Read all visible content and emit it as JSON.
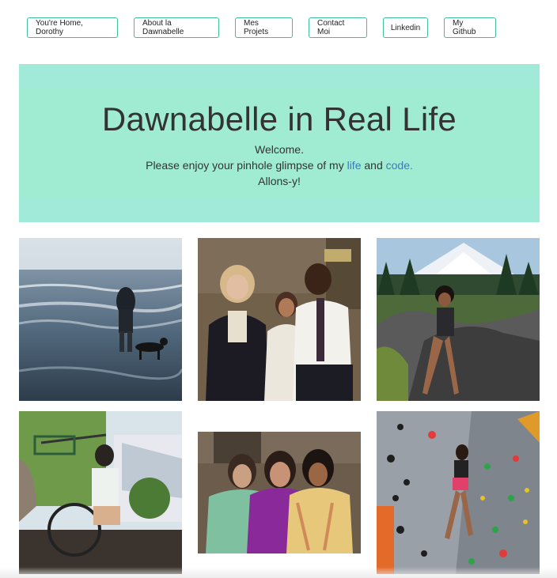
{
  "nav": {
    "items": [
      {
        "label": "You're Home, Dorothy"
      },
      {
        "label": "About la Dawnabelle"
      },
      {
        "label": "Mes Projets"
      },
      {
        "label": "Contact Moi"
      },
      {
        "label": "Linkedin"
      },
      {
        "label": "My Github"
      }
    ]
  },
  "hero": {
    "title": "Dawnabelle in Real Life",
    "welcome": "Welcome.",
    "line_prefix": "Please enjoy your pinhole glimpse of my",
    "life_link": "life",
    "and_word": "and",
    "code_link": "code.",
    "signoff": "Allons-y!"
  },
  "colors": {
    "accent_border": "#3fbf99",
    "hero_bg": "#a0ecd2",
    "link": "#3a7bb8"
  }
}
